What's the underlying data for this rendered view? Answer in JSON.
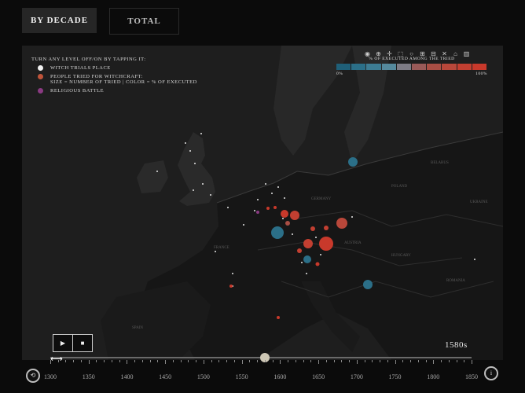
{
  "tabs": [
    "BY DECADE",
    "TOTAL"
  ],
  "legend": {
    "title": "TURN ANY LEVEL OFF/ON BY TAPPING IT:",
    "items": [
      {
        "label": "WITCH TRIALS PLACE",
        "color": "#f2f2f2"
      },
      {
        "label": "PEOPLE TRIED FOR WITCHCRAFT:\nSIZE = NUMBER OF TRIED | COLOR = % OF EXECUTED",
        "color": "#c0543a"
      },
      {
        "label": "RELIGIOUS BATTLE",
        "color": "#8a3a82"
      }
    ]
  },
  "scale": {
    "title": "% OF EXECUTED AMONG THE TRIED",
    "min_label": "0%",
    "max_label": "100%",
    "colors": [
      "#1f5f78",
      "#2b6f88",
      "#3d7c93",
      "#55899c",
      "#7d7b84",
      "#9a5a58",
      "#a94e44",
      "#b8473a",
      "#c23f31",
      "#c8392b"
    ]
  },
  "toolbar_icons": [
    "camera-icon",
    "zoom-in-icon",
    "pan-icon",
    "box-select-icon",
    "lasso-icon",
    "zoom-plus-icon",
    "zoom-minus-icon",
    "autoscale-icon",
    "home-icon",
    "bar-chart-icon"
  ],
  "controls": {
    "play": "▶",
    "stop": "■"
  },
  "current_decade": "1580s",
  "timeline": {
    "labels": [
      "1300",
      "1350",
      "1400",
      "1450",
      "1500",
      "1550",
      "1600",
      "1650",
      "1700",
      "1750",
      "1800",
      "1850"
    ],
    "start": 1300,
    "end": 1850,
    "current": 1580
  },
  "map_labels": [
    "GERMANY",
    "FRANCE",
    "POLAND",
    "ROMANIA",
    "HUNGARY",
    "AUSTRIA",
    "SPAIN",
    "BELARUS",
    "UKRAINE"
  ]
}
